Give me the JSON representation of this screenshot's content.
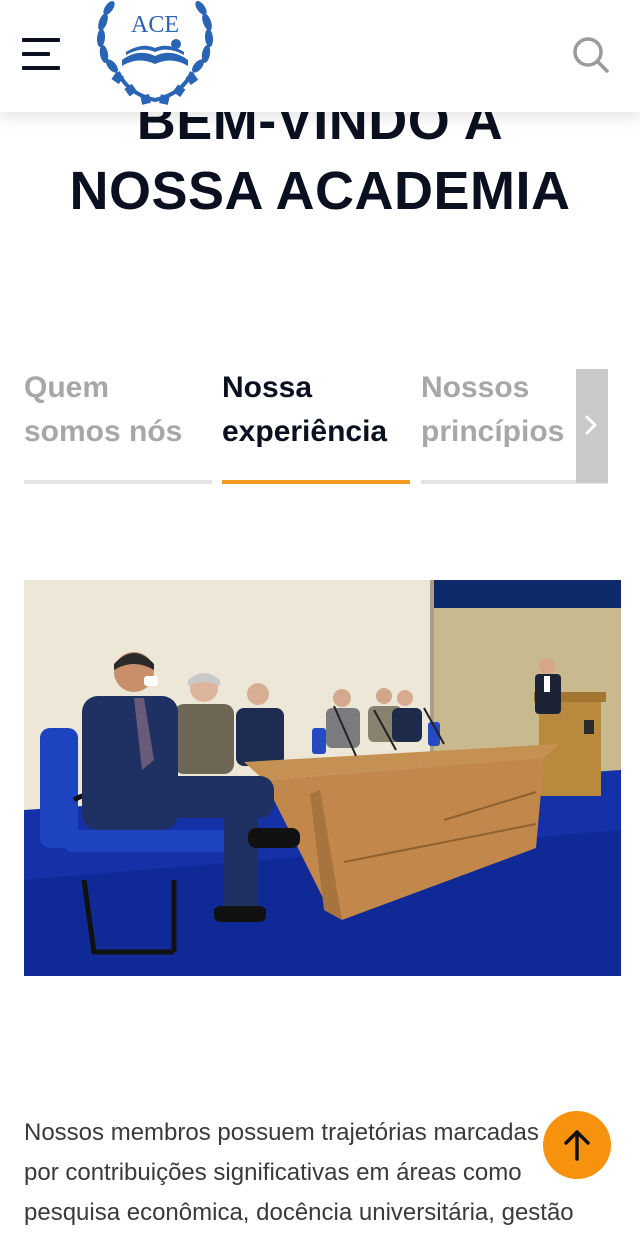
{
  "header": {
    "logo_text": "ACE",
    "menu_icon": "hamburger-menu-icon",
    "search_icon": "search-icon"
  },
  "hero": {
    "title_line1": "BEM-VINDO A",
    "title_line2": "NOSSA ACADEMIA"
  },
  "tabs": [
    {
      "line1": "Quem",
      "line2": "somos nós",
      "active": false
    },
    {
      "line1": "Nossa",
      "line2": "experiência",
      "active": true
    },
    {
      "line1": "Nossos",
      "line2": "princípios",
      "active": false
    }
  ],
  "tabs_next_icon": "chevron-right-icon",
  "content": {
    "paragraph_line1": "Nossos membros possuem trajetórias marcadas",
    "paragraph_line2": "por contribuições significativas em áreas como",
    "paragraph_line3": "pesquisa econômica, docência universitária, gestão"
  },
  "back_to_top_icon": "arrow-up-icon",
  "colors": {
    "accent": "#f29a21",
    "title": "#0b1020",
    "inactive_tab": "#a7a7a7",
    "logo_blue": "#2a64b4"
  }
}
